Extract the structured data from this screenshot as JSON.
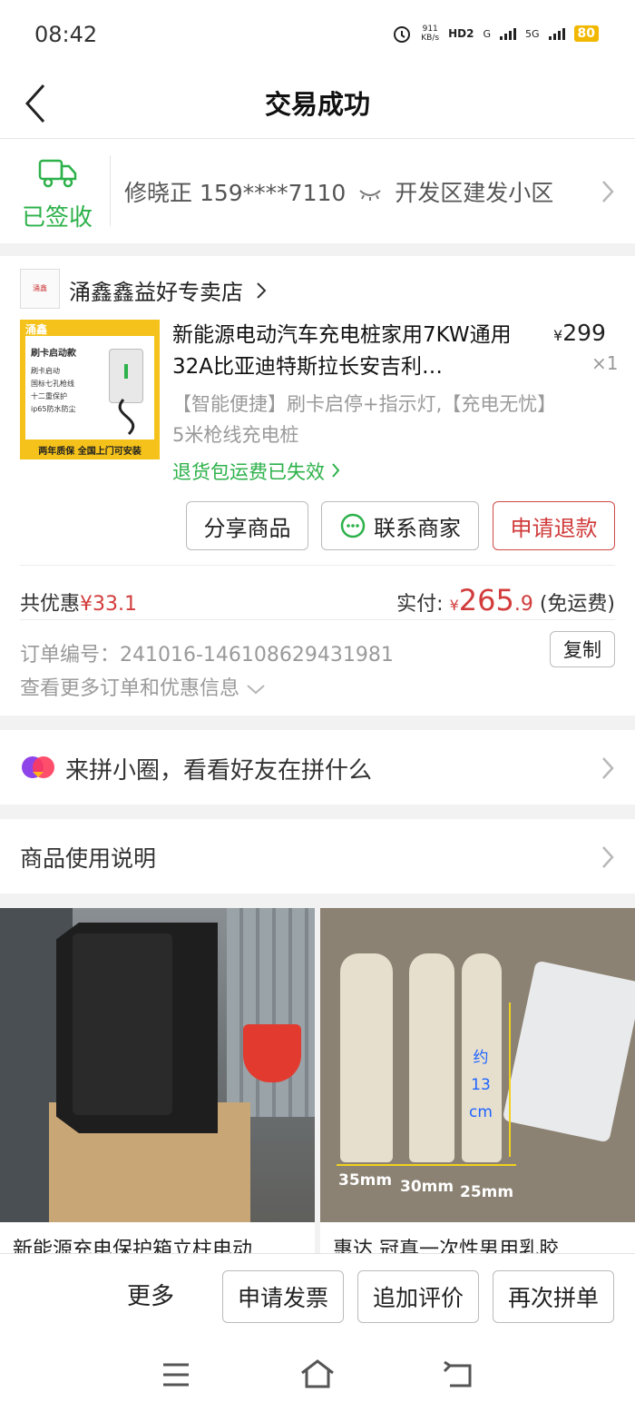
{
  "status_bar": {
    "time": "08:42",
    "network_speed": "911\nKB/s",
    "hd": "HD2",
    "g": "G",
    "fiveg": "5G",
    "battery": "80"
  },
  "header": {
    "title": "交易成功"
  },
  "address": {
    "status": "已签收",
    "text": "修晓正 159****7110",
    "area": "开发区建发小区"
  },
  "order": {
    "shop": {
      "name": "涌鑫鑫益好专卖店",
      "logo_text": "涌鑫"
    },
    "product": {
      "title": "新能源电动汽车充电桩家用7KW通用32A比亚迪特斯拉长安吉利…",
      "price_symbol": "¥",
      "price": "299",
      "qty": "×1",
      "spec": "【智能便捷】刷卡启停+指示灯,【充电无忧】5米枪线充电桩",
      "refund_note": "退货包运费已失效",
      "image_texts": {
        "brand": "涌鑫",
        "card": "刷卡启动款",
        "f1": "刷卡启动",
        "f2": "国标七孔枪线",
        "f3": "十二重保护",
        "f4": "ip65防水防尘",
        "bottom": "两年质保  全国上门可安装"
      }
    },
    "buttons": {
      "share": "分享商品",
      "contact": "联系商家",
      "refund": "申请退款"
    },
    "discount_label": "共优惠",
    "discount_value": "¥33.1",
    "paid_label": "实付:",
    "paid_symbol": "¥",
    "paid_int": "265",
    "paid_dec": ".9",
    "paid_note": "(免运费)",
    "order_no": "订单编号：241016-146108629431981",
    "copy_label": "复制",
    "more_info": "查看更多订单和优惠信息"
  },
  "circle": {
    "text": "来拼小圈，看看好友在拼什么"
  },
  "manual": {
    "text": "商品使用说明"
  },
  "recommend": [
    {
      "title": "新能源充电保护箱立柱电动"
    },
    {
      "title": "惠达 冠真一次性男用乳胶",
      "labels": {
        "size1": "35mm",
        "size2": "30mm",
        "size3": "25mm",
        "about": "约",
        "length": "13",
        "unit": "cm"
      }
    }
  ],
  "bottom_bar": {
    "more": "更多",
    "invoice": "申请发票",
    "review": "追加评价",
    "reorder": "再次拼单"
  },
  "colors": {
    "accent_green": "#2db14a",
    "price_red": "#d23c3c",
    "battery": "#f2b800"
  }
}
